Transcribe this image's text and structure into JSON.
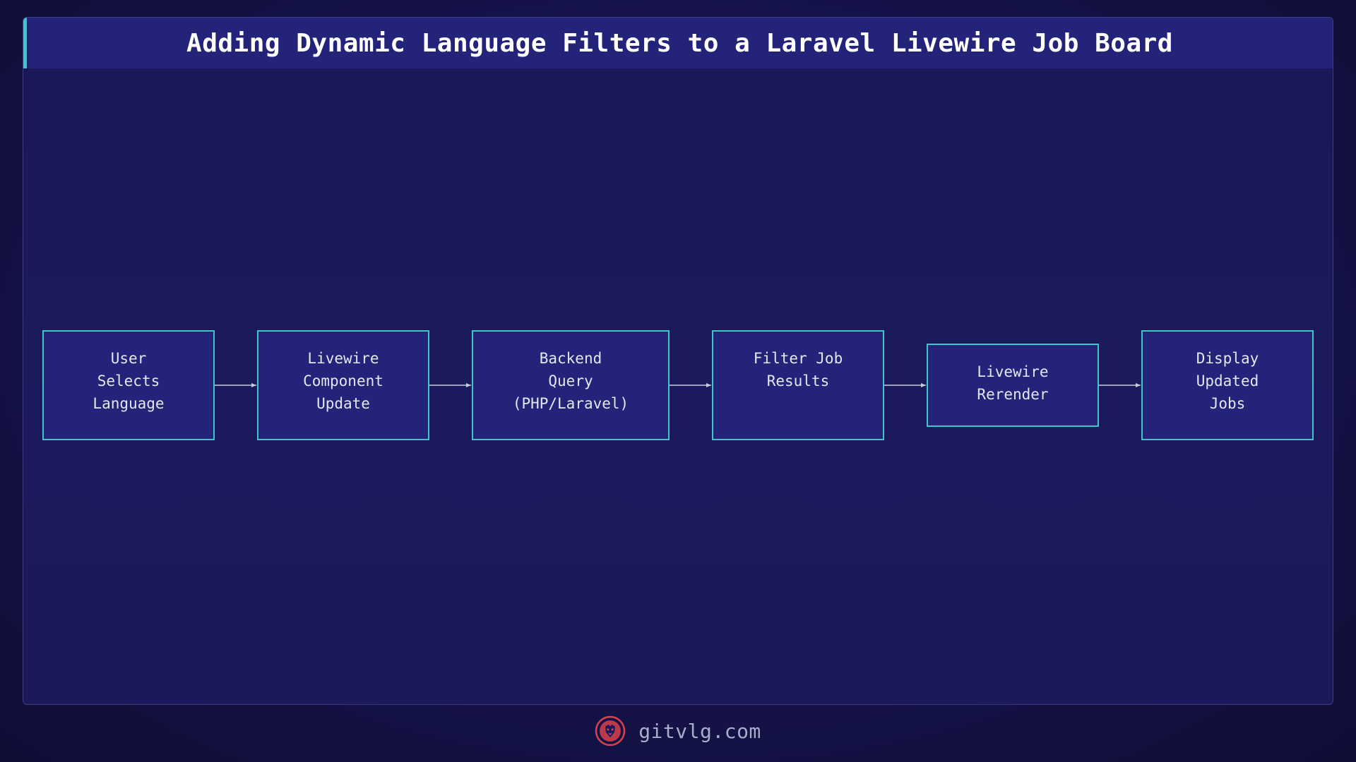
{
  "title": "Adding Dynamic Language Filters to a Laravel Livewire Job Board",
  "colors": {
    "background": "#15134a",
    "title_bar": "#23237a",
    "accent": "#3ec7c9",
    "node_fill": "#23237a",
    "node_border": "#3ec7c9",
    "node_text": "#e4e6f4",
    "edge": "#c9cce0",
    "logo": "#d8424a"
  },
  "nodes": [
    {
      "id": "n1",
      "label": "User\nSelects\nLanguage"
    },
    {
      "id": "n2",
      "label": "Livewire\nComponent\nUpdate"
    },
    {
      "id": "n3",
      "label": "Backend\nQuery\n(PHP/Laravel)"
    },
    {
      "id": "n4",
      "label": "Filter Job\nResults"
    },
    {
      "id": "n5",
      "label": "Livewire\nRerender"
    },
    {
      "id": "n6",
      "label": "Display\nUpdated\nJobs"
    }
  ],
  "edges": [
    {
      "from": "n1",
      "to": "n2"
    },
    {
      "from": "n2",
      "to": "n3"
    },
    {
      "from": "n3",
      "to": "n4"
    },
    {
      "from": "n4",
      "to": "n5"
    },
    {
      "from": "n5",
      "to": "n6"
    }
  ],
  "footer": {
    "logo_icon": "lion-head-icon",
    "site": "gitvlg.com"
  }
}
